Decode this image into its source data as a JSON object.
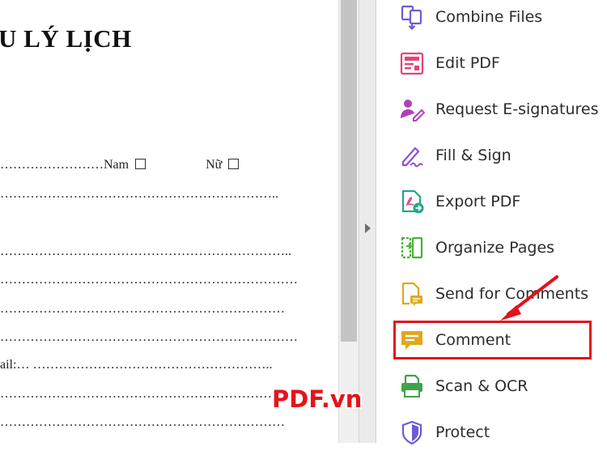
{
  "document": {
    "title": "U LÝ LỊCH",
    "lines": [
      {
        "id": "line-1",
        "text": "……………………Nam",
        "after_box_text": "Nữ"
      },
      {
        "id": "line-2",
        "text": "……………………………………………………….."
      },
      {
        "id": "line-3",
        "text": "………………………………………………………….."
      },
      {
        "id": "line-4",
        "text": "……………………………………………………………"
      },
      {
        "id": "line-5",
        "text": "…………………………………………………………"
      },
      {
        "id": "line-6",
        "text": "……………………………………………………………"
      },
      {
        "id": "line-7",
        "text": "ail:… ……………………………………………….."
      },
      {
        "id": "line-8",
        "text": "…………………………………………………………."
      },
      {
        "id": "line-9",
        "text": "…………………………………………………………"
      }
    ]
  },
  "tools_panel": {
    "items": [
      {
        "label": "Combine Files",
        "icon": "combine-files-icon",
        "color": "#6b5bd6"
      },
      {
        "label": "Edit PDF",
        "icon": "edit-pdf-icon",
        "color": "#e1457a"
      },
      {
        "label": "Request E-signatures",
        "icon": "request-esignatures-icon",
        "color": "#b33fb8"
      },
      {
        "label": "Fill & Sign",
        "icon": "fill-sign-icon",
        "color": "#8f52d6"
      },
      {
        "label": "Export PDF",
        "icon": "export-pdf-icon",
        "color": "#2aa38a"
      },
      {
        "label": "Organize Pages",
        "icon": "organize-pages-icon",
        "color": "#4caf3b"
      },
      {
        "label": "Send for Comments",
        "icon": "send-for-comments-icon",
        "color": "#e0a81c"
      },
      {
        "label": "Comment",
        "icon": "comment-icon",
        "color": "#e0a81c"
      },
      {
        "label": "Scan & OCR",
        "icon": "scan-ocr-icon",
        "color": "#3ea34a"
      },
      {
        "label": "Protect",
        "icon": "protect-icon",
        "color": "#6b5bd6"
      }
    ]
  },
  "annotation": {
    "watermark": "PDF.vn",
    "highlight_color": "#e3111b"
  }
}
